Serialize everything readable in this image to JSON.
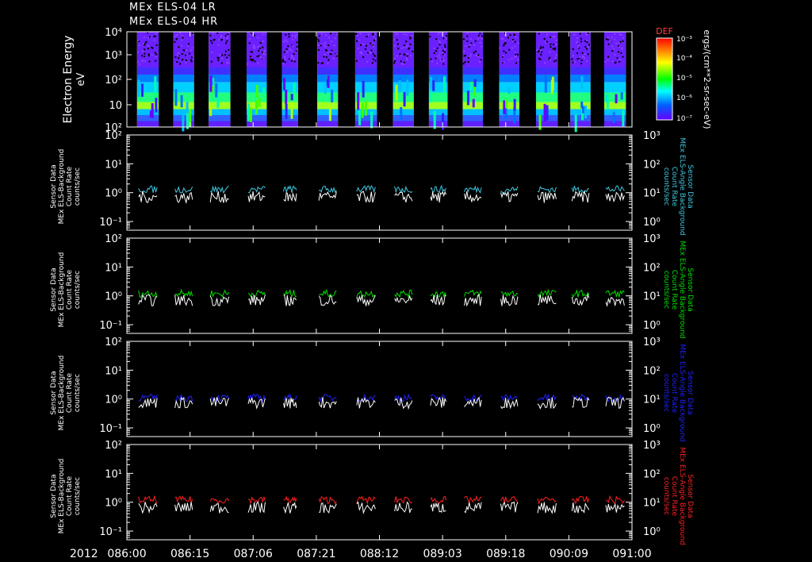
{
  "header": {
    "line1": "MEx ELS-04 LR",
    "line2": "MEx ELS-04 HR"
  },
  "time_axis": {
    "year": "2012",
    "ticks": [
      "086:00",
      "086:15",
      "087:06",
      "087:21",
      "088:12",
      "089:03",
      "089:18",
      "090:09",
      "091:00"
    ]
  },
  "chart_data": [
    {
      "type": "heatmap",
      "panel": "spectrogram",
      "ylabel": [
        "Electron Energy",
        "eV"
      ],
      "y_ticks": [
        "10",
        "10",
        "10",
        "10",
        "10"
      ],
      "y_tick_exps": [
        "",
        "2",
        "3",
        "4",
        ""
      ],
      "y_tick_special": [
        "10²",
        "10",
        "10²",
        "10³",
        "10⁴"
      ],
      "ylim": [
        1,
        10000
      ],
      "scale": "log",
      "colorbar": {
        "label": "DEF",
        "units": "ergs/(cm**2-sr-sec-eV)",
        "ticks": [
          "10⁻³",
          "10⁻⁴",
          "10⁻⁵",
          "10⁻⁶",
          "10⁻⁷"
        ],
        "colors": [
          "#ff0000",
          "#ff8000",
          "#ffff00",
          "#00ff00",
          "#00ffff",
          "#0060ff",
          "#6600ff"
        ]
      },
      "data_intervals": [
        [
          0.02,
          0.063
        ],
        [
          0.092,
          0.133
        ],
        [
          0.162,
          0.205
        ],
        [
          0.237,
          0.277
        ],
        [
          0.307,
          0.339
        ],
        [
          0.377,
          0.418
        ],
        [
          0.452,
          0.495
        ],
        [
          0.527,
          0.568
        ],
        [
          0.598,
          0.635
        ],
        [
          0.665,
          0.705
        ],
        [
          0.737,
          0.777
        ],
        [
          0.81,
          0.853
        ],
        [
          0.878,
          0.918
        ],
        [
          0.945,
          0.988
        ]
      ]
    },
    {
      "type": "line",
      "panel": "background-1",
      "ylabel_left": [
        "Sensor Data",
        "MEx ELS-Background",
        "Count Rate",
        "counts/sec"
      ],
      "ylabel_right": [
        "Sensor Data",
        "MEx ELS-Angle Background",
        "Count Rate",
        "counts/sec"
      ],
      "left_ticks": [
        "10²",
        "10¹",
        "10⁰",
        "10⁻¹"
      ],
      "right_ticks": [
        "10³",
        "10²",
        "10¹",
        "10⁰"
      ],
      "ylim_left": [
        0.05,
        100
      ],
      "ylim_right": [
        0.5,
        1000
      ],
      "series": [
        {
          "color": "#40c8e0",
          "level": 1.3
        },
        {
          "color": "#ffffff",
          "level": 0.7
        }
      ]
    },
    {
      "type": "line",
      "panel": "background-2",
      "ylabel_left": [
        "Sensor Data",
        "MEx ELS-Background",
        "Count Rate",
        "counts/sec"
      ],
      "ylabel_right": [
        "Sensor Data",
        "MEx ELS-Angle Background",
        "Count Rate",
        "counts/sec"
      ],
      "left_ticks": [
        "10²",
        "10¹",
        "10⁰",
        "10⁻¹"
      ],
      "right_ticks": [
        "10³",
        "10²",
        "10¹",
        "10⁰"
      ],
      "ylim_left": [
        0.05,
        100
      ],
      "ylim_right": [
        0.5,
        1000
      ],
      "series": [
        {
          "color": "#00e000",
          "level": 1.2
        },
        {
          "color": "#ffffff",
          "level": 0.7
        }
      ]
    },
    {
      "type": "line",
      "panel": "background-3",
      "ylabel_left": [
        "Sensor Data",
        "MEx ELS-Background",
        "Count Rate",
        "counts/sec"
      ],
      "ylabel_right": [
        "Sensor Data",
        "MEx ELS-Angle Background",
        "Count Rate",
        "counts/sec"
      ],
      "left_ticks": [
        "10²",
        "10¹",
        "10⁰",
        "10⁻¹"
      ],
      "right_ticks": [
        "10³",
        "10²",
        "10¹",
        "10⁰"
      ],
      "ylim_left": [
        0.05,
        100
      ],
      "ylim_right": [
        0.5,
        1000
      ],
      "series": [
        {
          "color": "#2020ff",
          "level": 1.1
        },
        {
          "color": "#ffffff",
          "level": 0.75
        }
      ]
    },
    {
      "type": "line",
      "panel": "background-4",
      "ylabel_left": [
        "Sensor Data",
        "MEx ELS-Background",
        "Count Rate",
        "counts/sec"
      ],
      "ylabel_right": [
        "Sensor Data",
        "MEx ELS-Angle Background",
        "Count Rate",
        "counts/sec"
      ],
      "left_ticks": [
        "10²",
        "10¹",
        "10⁰",
        "10⁻¹"
      ],
      "right_ticks": [
        "10³",
        "10²",
        "10¹",
        "10⁰"
      ],
      "ylim_left": [
        0.05,
        100
      ],
      "ylim_right": [
        0.5,
        1000
      ],
      "series": [
        {
          "color": "#ff2020",
          "level": 1.2
        },
        {
          "color": "#ffffff",
          "level": 0.65
        }
      ]
    }
  ]
}
